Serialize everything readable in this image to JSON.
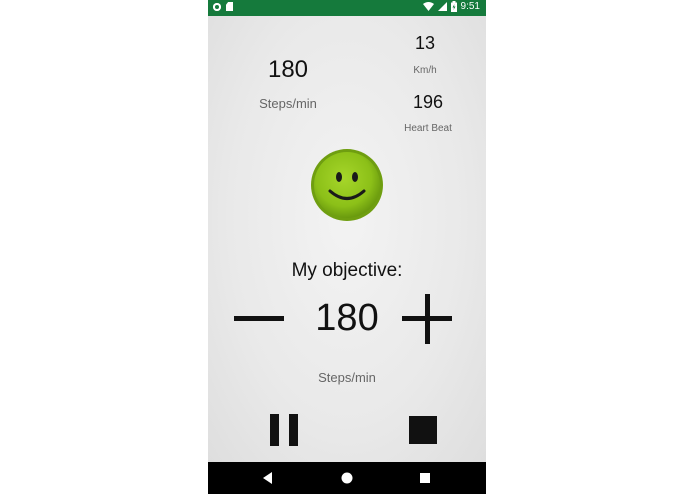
{
  "status_bar": {
    "time": "9:51",
    "icons": [
      "circle-notification-icon",
      "sd-card-icon",
      "wifi-icon",
      "cell-signal-icon",
      "battery-charging-icon"
    ],
    "background_color": "#157a3c"
  },
  "current": {
    "steps_per_min_value": "180",
    "steps_per_min_label": "Steps/min",
    "speed_value": "13",
    "speed_label": "Km/h",
    "heart_beat_value": "196",
    "heart_beat_label": "Heart Beat"
  },
  "status_indicator": {
    "icon": "smiley-face-icon",
    "color": "#8fc41a"
  },
  "objective": {
    "label": "My objective:",
    "value": "180",
    "unit": "Steps/min",
    "decrease_icon": "minus-icon",
    "increase_icon": "plus-icon"
  },
  "controls": {
    "pause_icon": "pause-icon",
    "stop_icon": "stop-icon"
  },
  "nav_bar": {
    "icons": [
      "back-icon",
      "home-icon",
      "recents-icon"
    ]
  }
}
